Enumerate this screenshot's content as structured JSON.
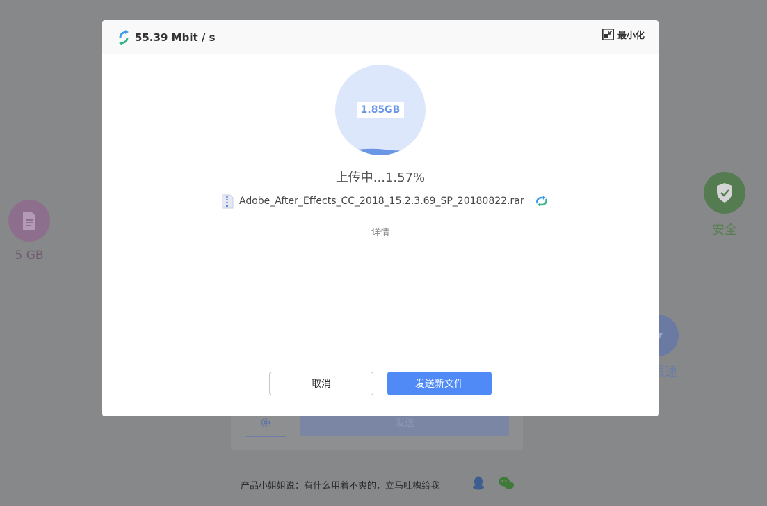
{
  "background": {
    "size_feature": {
      "label": "5 GB",
      "icon": "document-icon"
    },
    "safe_feature": {
      "label": "安全",
      "icon": "shield-check-icon"
    },
    "speed_feature": {
      "label": "限速",
      "icon": "lightning-icon"
    },
    "send_button_label": "发送",
    "footer_text": "产品小姐姐说：有什么用着不爽的，立马吐槽给我",
    "footer_icons": [
      "qq-icon",
      "wechat-icon"
    ]
  },
  "modal": {
    "speed": "55.39 Mbit / s",
    "minimize_label": "最小化",
    "file_size": "1.85GB",
    "progress_percent": 1.57,
    "status": "上传中...1.57%",
    "file_name": "Adobe_After_Effects_CC_2018_15.2.3.69_SP_20180822.rar",
    "details_label": "详情",
    "cancel_label": "取消",
    "send_new_label": "发送新文件"
  },
  "colors": {
    "primary": "#4f8af7",
    "progress_bg": "#dde7fb",
    "progress_fill": "#6a96e6"
  }
}
